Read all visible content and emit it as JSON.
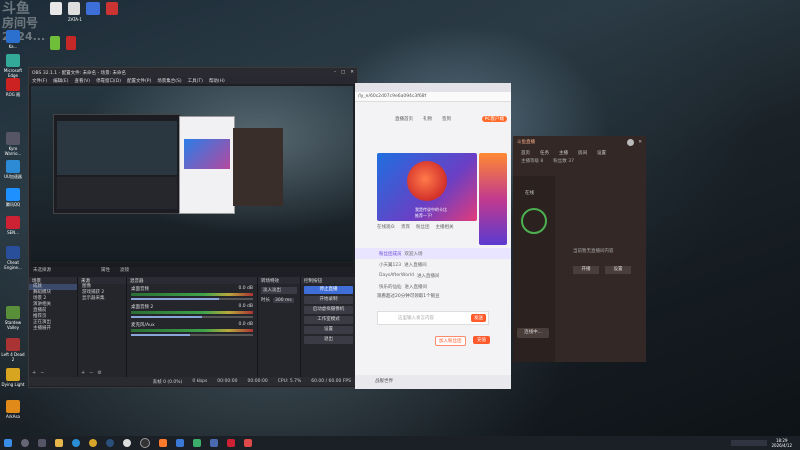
{
  "desktop": {
    "watermark": [
      "斗鱼",
      "房间号",
      "2624..."
    ],
    "icons": [
      {
        "label": "Ka..."
      },
      {
        "label": "Microsoft Edge"
      },
      {
        "label": "ROG 随"
      },
      {
        "label": "Kyro Warrio..."
      },
      {
        "label": "UU加速器"
      },
      {
        "label": "腾讯QQ"
      },
      {
        "label": "SEN..."
      },
      {
        "label": "Cheat Engine..."
      },
      {
        "label": "Stardew Valley"
      },
      {
        "label": "Left 4 Dead 2"
      },
      {
        "label": "Dying Light"
      },
      {
        "label": "ArkAsa"
      }
    ],
    "top_icons": [
      "",
      "",
      "ZATA-1",
      "",
      "",
      "",
      "",
      ""
    ]
  },
  "obs": {
    "title": "OBS 32.1.1 - 配置文件: 未命名 - 场景: 未命名",
    "menu": [
      "文件(F)",
      "编辑(E)",
      "查看(V)",
      "停靠窗口(D)",
      "配置文件(P)",
      "场景集合(S)",
      "工具(T)",
      "帮助(H)"
    ],
    "source_bar": {
      "label": "未选择源",
      "props": "属性",
      "filters": "滤镜"
    },
    "scenes": {
      "title": "场景",
      "items": [
        "成就",
        "舞蹈模块",
        "场景 2",
        "演讲相关",
        "直播前",
        "推荐页",
        "正在演出",
        "主播展开"
      ]
    },
    "sources": {
      "title": "来源",
      "items": [
        "图像",
        "游戏捕获 2",
        "显示器采集"
      ]
    },
    "mixer": {
      "title": "混音器",
      "channels": [
        {
          "name": "桌面音频",
          "db": "0.0 dB",
          "level": 0.72
        },
        {
          "name": "桌面音频 2",
          "db": "0.0 dB",
          "level": 0.58
        },
        {
          "name": "麦克风/Aux",
          "db": "0.0 dB",
          "level": 0.48
        }
      ]
    },
    "transitions": {
      "title": "转场特效",
      "type": "淡入淡出",
      "duration_label": "时长",
      "duration": "300 ms"
    },
    "controls": {
      "title": "控制按钮",
      "buttons": [
        "停止直播",
        "开始录制",
        "启动虚拟摄像机",
        "工作室模式",
        "设置",
        "退出"
      ]
    },
    "status": {
      "frames": "丢帧 0 (0.0%)",
      "rec": "00:00:00",
      "stream": "00:00:00",
      "cpu": "CPU: 5.7%",
      "fps": "60.00 / 60.00 FPS",
      "bitrate": "0 kbps"
    }
  },
  "browser": {
    "url": "/ly_e/60c2d07c9e6a094c3f68f",
    "nav_items": [
      "直播首页",
      "礼物",
      "签到"
    ],
    "pc_btn": "PC客户端",
    "promo": {
      "caption": "我是传说中的卡比",
      "sub": "推荐一下!"
    },
    "tabs": [
      "在线观众",
      "贵宾",
      "粉丝团",
      "主播相关"
    ],
    "chat": [
      {
        "user": "粉丝团成员",
        "text": "欢迎入场"
      },
      {
        "user": "小天翼123",
        "text": "进入直播间"
      },
      {
        "user": "DaysAfterWorld",
        "text": "进入直播间"
      },
      {
        "user": "快乐的仙仙",
        "text": "进入直播间"
      }
    ],
    "notice": "观看超过20分钟可领取1个银豆",
    "input_placeholder": "这里输入发言内容",
    "send": "发送",
    "join": "加入粉丝团",
    "buy": "充值",
    "footer": "战舰世界"
  },
  "app2": {
    "title": "斗鱼直播",
    "tabs": [
      "首页",
      "任务",
      "主播",
      "房间",
      "设置"
    ],
    "stats": [
      "主播等级 8",
      "粉丝数 37"
    ],
    "status": "在线",
    "message": "当前暂无直播间内容",
    "btn1": "开播",
    "btn2": "设置",
    "bottom_btn": "连线中..."
  },
  "taskbar": {
    "apps": [
      "start",
      "search",
      "task",
      "explorer",
      "edge",
      "chrome",
      "steam",
      "qq",
      "obs",
      "douyu",
      "files",
      "game",
      "cheat",
      "netease",
      "music"
    ],
    "time": "18:29",
    "date": "2026/4/12"
  }
}
